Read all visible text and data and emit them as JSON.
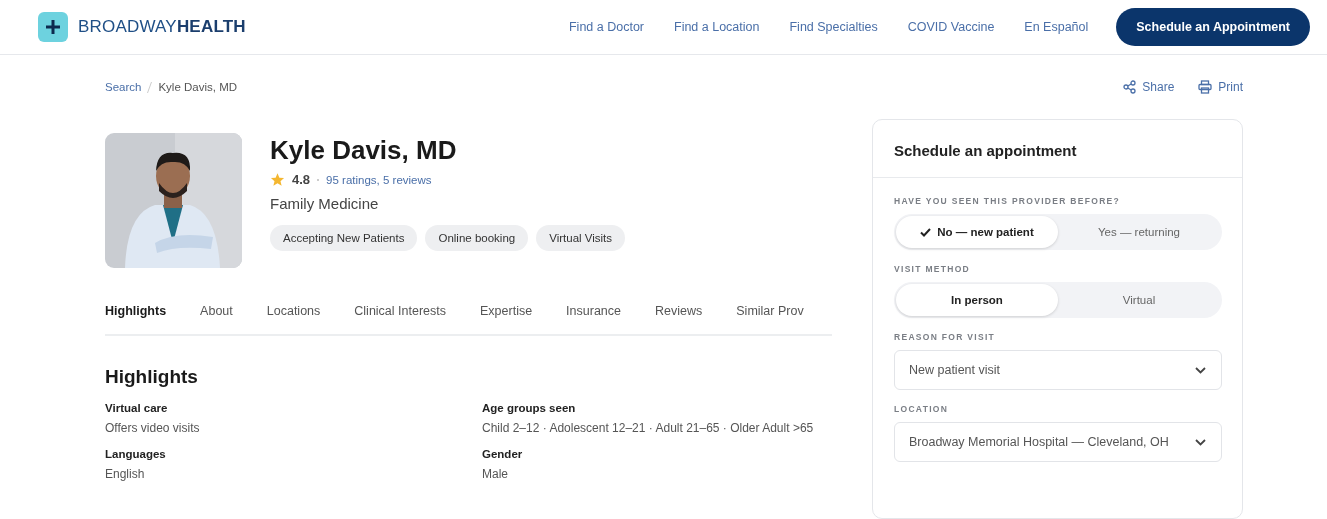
{
  "header": {
    "logo": {
      "light": "BROADWAY",
      "bold": "HEALTH"
    },
    "nav": [
      "Find a Doctor",
      "Find a Location",
      "Find Specialties",
      "COVID Vaccine",
      "En Español"
    ],
    "cta": "Schedule an Appointment"
  },
  "breadcrumb": [
    "Search",
    "Kyle Davis, MD"
  ],
  "actions": [
    {
      "kind": "share",
      "label": "Share"
    },
    {
      "kind": "print",
      "label": "Print"
    }
  ],
  "profile": {
    "photo": {
      "kind": "picture"
    },
    "name": "Kyle Davis, MD",
    "rating": "4.8",
    "ratings_link": "95 ratings, 5 reviews",
    "specialty": "Family Medicine",
    "tags": [
      "Accepting New Patients",
      "Online booking",
      "Virtual Visits"
    ]
  },
  "tabs": [
    {
      "label": "Highlights",
      "selected": true
    },
    {
      "label": "About",
      "selected": false
    },
    {
      "label": "Locations",
      "selected": false
    },
    {
      "label": "Clinical Interests",
      "selected": false
    },
    {
      "label": "Expertise",
      "selected": false
    },
    {
      "label": "Insurance",
      "selected": false
    },
    {
      "label": "Reviews",
      "selected": false
    },
    {
      "label": "Similar Prov",
      "selected": false
    }
  ],
  "highlights": {
    "title": "Highlights",
    "items": [
      {
        "label": "Virtual care",
        "value": "Offers video visits"
      },
      {
        "label": "Age groups seen",
        "value": "Child 2–12 · Adolescent 12–21 · Adult 21–65 · Older Adult >65"
      },
      {
        "label": "Languages",
        "value": "English"
      },
      {
        "label": "Gender",
        "value": "Male"
      }
    ]
  },
  "schedule": {
    "title": "Schedule an appointment",
    "fields": [
      {
        "kind": "toggle",
        "label": "HAVE YOU SEEN THIS PROVIDER BEFORE?",
        "options": [
          {
            "label": "No — new patient",
            "selected": true,
            "check": true
          },
          {
            "label": "Yes — returning",
            "selected": false,
            "check": false
          }
        ]
      },
      {
        "kind": "toggle",
        "label": "VISIT METHOD",
        "options": [
          {
            "label": "In person",
            "selected": true,
            "check": false
          },
          {
            "label": "Virtual",
            "selected": false,
            "check": false
          }
        ]
      },
      {
        "kind": "select",
        "label": "REASON FOR VISIT",
        "value": "New patient visit"
      },
      {
        "kind": "select",
        "label": "LOCATION",
        "value": "Broadway Memorial Hospital — Cleveland, OH"
      }
    ]
  }
}
